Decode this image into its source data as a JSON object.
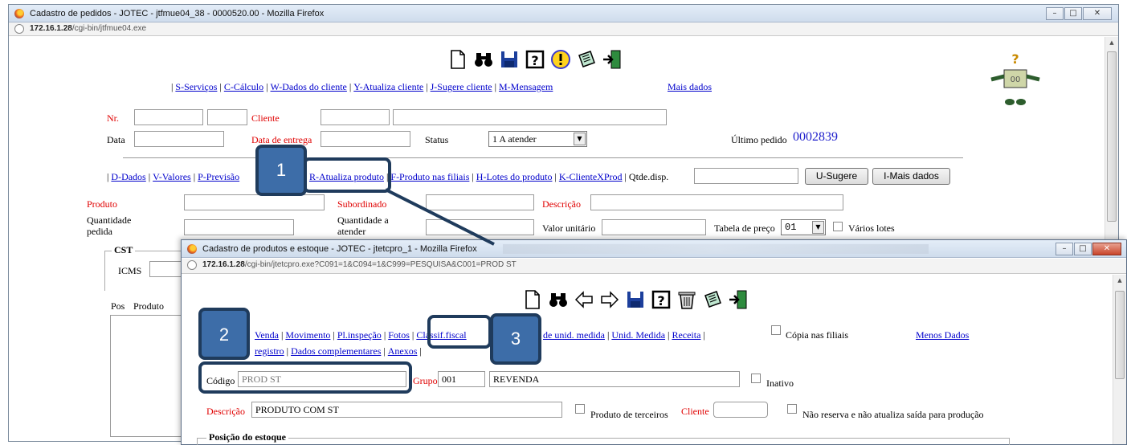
{
  "main_window": {
    "title": "Cadastro de pedidos - JOTEC - jtfmue04_38 - 0000520.00 - Mozilla Firefox",
    "url_host": "172.16.1.28",
    "url_path": "/cgi-bin/jtfmue04.exe",
    "toolbar_icons": [
      "new-document-icon",
      "binoculars-icon",
      "save-disk-icon",
      "help-icon",
      "warning-icon",
      "notes-icon",
      "exit-icon"
    ],
    "menu": [
      {
        "label": "S-Serviços"
      },
      {
        "label": "C-Cálculo"
      },
      {
        "label": "W-Dados do cliente"
      },
      {
        "label": "Y-Atualiza cliente"
      },
      {
        "label": "J-Sugere cliente"
      },
      {
        "label": "M-Mensagem"
      }
    ],
    "mais_dados": "Mais dados",
    "labels": {
      "nr": "Nr.",
      "cliente": "Cliente",
      "data": "Data",
      "data_entrega": "Data de entrega",
      "status": "Status",
      "ultimo_pedido": "Último pedido"
    },
    "status_value": "1 A atender",
    "ultimo_pedido_value": "0002839",
    "menu2": [
      {
        "label": "D-Dados"
      },
      {
        "label": "V-Valores"
      },
      {
        "label": "P-Previsão"
      },
      {
        "label": "R-Atualiza produto"
      },
      {
        "label": "F-Produto nas filiais"
      },
      {
        "label": "H-Lotes do produto"
      },
      {
        "label": "K-ClienteXProd"
      }
    ],
    "qtde_disp": "Qtde.disp.",
    "buttons": {
      "sugere": "U-Sugere",
      "mais_dados": "I-Mais dados"
    },
    "product_labels": {
      "produto": "Produto",
      "subordinado": "Subordinado",
      "descricao": "Descrição",
      "quantidade_pedida": "Quantidade pedida",
      "quantidade_atender": "Quantidade a atender",
      "valor_unitario": "Valor unitário",
      "tabela_preco": "Tabela de preço",
      "varios_lotes": "Vários lotes"
    },
    "tabela_preco_value": "01",
    "cst_label": "CST",
    "icms_label": "ICMS",
    "grid_headers": {
      "pos": "Pos",
      "produto": "Produto"
    }
  },
  "sub_window": {
    "title": "Cadastro de produtos e estoque - JOTEC - jtetcpro_1 - Mozilla Firefox",
    "url_host": "172.16.1.28",
    "url_path": "/cgi-bin/jtetcpro.exe?C091=1&C094=1&C999=PESQUISA&C001=PROD ST",
    "toolbar_icons": [
      "new-document-icon",
      "binoculars-icon",
      "arrow-left-icon",
      "arrow-right-icon",
      "save-disk-icon",
      "help-icon",
      "trash-icon",
      "notes-icon",
      "exit-icon"
    ],
    "menu_row1": [
      {
        "label": "Venda"
      },
      {
        "label": "Movimento"
      },
      {
        "label": "Pl.inspeção"
      },
      {
        "label": "Fotos"
      },
      {
        "label": "Classif.fiscal"
      },
      {
        "label": "de unid. medida"
      },
      {
        "label": "Unid. Medida"
      },
      {
        "label": "Receita"
      }
    ],
    "menu_row2": [
      {
        "label": "registro"
      },
      {
        "label": "Dados complementares"
      },
      {
        "label": "Anexos"
      }
    ],
    "copia_filiais": "Cópia nas filiais",
    "menos_dados": "Menos Dados",
    "codigo_label": "Código",
    "codigo_value": "PROD ST",
    "grupo_label": "Grupo",
    "grupo_code": "001",
    "grupo_name": "REVENDA",
    "inativo": "Inativo",
    "descricao_label": "Descrição",
    "descricao_value": "PRODUTO COM ST",
    "produto_terceiros": "Produto de terceiros",
    "cliente_label": "Cliente",
    "nao_reserva": "Não reserva e não atualiza saída para produção",
    "posicao_estoque": "Posição do estoque"
  },
  "callouts": [
    "1",
    "2",
    "3"
  ],
  "colors": {
    "link": "#0000cc",
    "required": "#e00000",
    "callout_fill": "#3d6da8",
    "callout_border": "#1f3b5c"
  }
}
